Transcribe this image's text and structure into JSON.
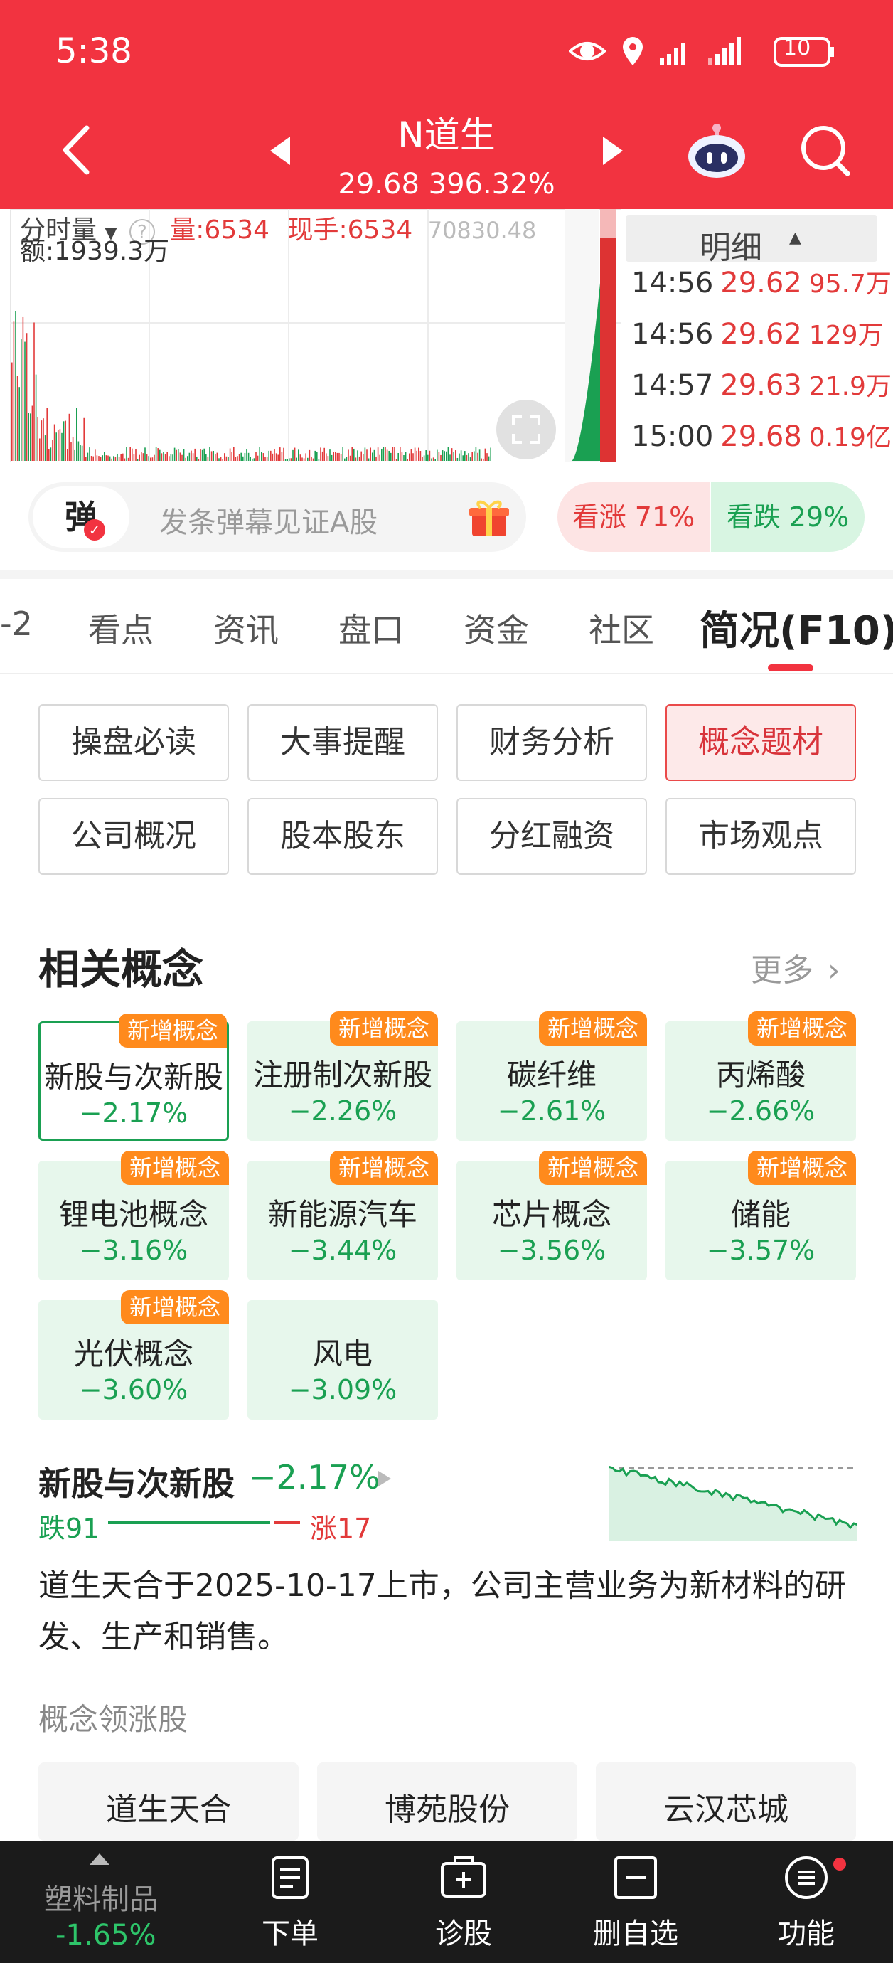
{
  "status_bar": {
    "time": "5:38",
    "battery": "10"
  },
  "header": {
    "stock_name": "N道生",
    "quote": "29.68 396.32%"
  },
  "chart": {
    "label_volume": "分时量",
    "label_vol_value": "量:6534",
    "label_current": "现手:6534",
    "label_number": "70830.48",
    "label_amount": "额:1939.3万"
  },
  "detail": {
    "title": "明细",
    "rows": [
      {
        "time": "14:56",
        "price": "29.62",
        "vol": "95.7万"
      },
      {
        "time": "14:56",
        "price": "29.62",
        "vol": "129万"
      },
      {
        "time": "14:57",
        "price": "29.63",
        "vol": "21.9万"
      },
      {
        "time": "15:00",
        "price": "29.68",
        "vol": "0.19亿"
      }
    ]
  },
  "danmu": {
    "button": "弹",
    "placeholder": "发条弹幕见证A股",
    "vote_up": "看涨 71%",
    "vote_down": "看跌 29%"
  },
  "tabs": {
    "items": [
      "看点",
      "资讯",
      "盘口",
      "资金",
      "社区",
      "简况(F10)"
    ],
    "partial": "-2"
  },
  "f10_buttons": [
    {
      "label": "操盘必读"
    },
    {
      "label": "大事提醒"
    },
    {
      "label": "财务分析"
    },
    {
      "label": "概念题材"
    },
    {
      "label": "公司概况"
    },
    {
      "label": "股本股东"
    },
    {
      "label": "分红融资"
    },
    {
      "label": "市场观点"
    }
  ],
  "related": {
    "title": "相关概念",
    "more": "更多",
    "badge": "新增概念",
    "concepts": [
      {
        "name": "新股与次新股",
        "pct": "−2.17%"
      },
      {
        "name": "注册制次新股",
        "pct": "−2.26%"
      },
      {
        "name": "碳纤维",
        "pct": "−2.61%"
      },
      {
        "name": "丙烯酸",
        "pct": "−2.66%"
      },
      {
        "name": "锂电池概念",
        "pct": "−3.16%"
      },
      {
        "name": "新能源汽车",
        "pct": "−3.44%"
      },
      {
        "name": "芯片概念",
        "pct": "−3.56%"
      },
      {
        "name": "储能",
        "pct": "−3.57%"
      },
      {
        "name": "光伏概念",
        "pct": "−3.60%"
      },
      {
        "name": "风电",
        "pct": "−3.09%"
      }
    ]
  },
  "summary": {
    "name": "新股与次新股",
    "pct": "−2.17%",
    "down_label": "跌91",
    "up_label": "涨17",
    "description": "道生天合于2025-10-17上市，公司主营业务为新材料的研发、生产和销售。"
  },
  "leaders": {
    "title": "概念领涨股",
    "items": [
      "道生天合",
      "博苑股份",
      "云汉芯城"
    ]
  },
  "bottom_nav": {
    "sector_name": "塑料制品",
    "sector_pct": "-1.65%",
    "items": [
      {
        "label": "下单"
      },
      {
        "label": "诊股"
      },
      {
        "label": "删自选"
      },
      {
        "label": "功能"
      }
    ]
  },
  "colors": {
    "brand_red": "#f23340",
    "up_red": "#e23a3a",
    "down_green": "#1aa052",
    "badge_orange": "#ff8a1c"
  }
}
